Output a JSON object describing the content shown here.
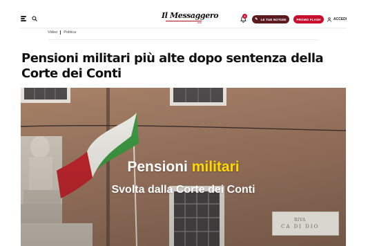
{
  "header": {
    "logo_text": "Il Messaggero",
    "logo_subtext": "1878",
    "notification_count": "3",
    "news_button": "LE TUE NOTIZIE",
    "flash_button": "PROMO FLASH",
    "login": "ACCEDI"
  },
  "breadcrumb": {
    "items": [
      "Video",
      "Politica"
    ]
  },
  "article": {
    "title": "Pensioni militari più alte dopo sentenza della Corte dei Conti"
  },
  "video": {
    "overlay_word1": "Pensioni",
    "overlay_word2": "militari",
    "overlay_subtitle": "Svolta dalla Corte dei Conti",
    "sign_line1": "RIVA",
    "sign_line2": "CA DI DIO"
  },
  "colors": {
    "brand_red": "#c8102e",
    "dark_red": "#5a1a1f",
    "overlay_highlight": "#ffd800"
  }
}
